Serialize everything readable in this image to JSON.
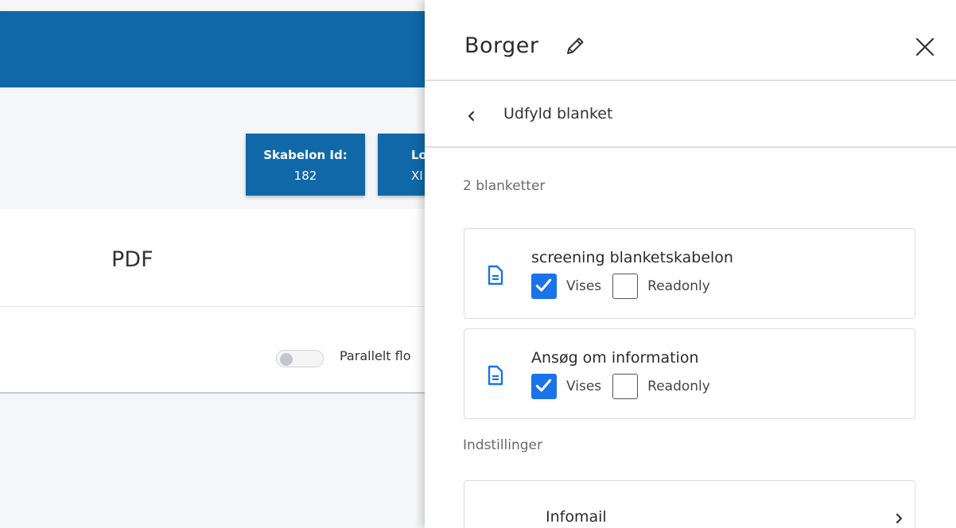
{
  "background": {
    "info_cards": [
      {
        "label": "Skabelon Id:",
        "value": "182"
      },
      {
        "label": "Lo",
        "value": "XI"
      }
    ],
    "pdf_title": "PDF",
    "toggle": {
      "label": "Parallelt flo",
      "on": false
    }
  },
  "panel": {
    "title": "Borger",
    "nav": {
      "back_label": "Udfyld blanket"
    },
    "forms_count": "2 blanketter",
    "forms": [
      {
        "name": "screening blanketskabelon",
        "vises_label": "Vises",
        "vises": true,
        "readonly_label": "Readonly",
        "readonly": false
      },
      {
        "name": "Ansøg om information",
        "vises_label": "Vises",
        "vises": true,
        "readonly_label": "Readonly",
        "readonly": false
      }
    ],
    "settings_label": "Indstillinger",
    "settings_items": [
      {
        "label": "Infomail"
      }
    ]
  },
  "colors": {
    "brand_blue": "#1168a8",
    "checkbox_blue": "#1a73e8",
    "doc_icon_blue": "#1a73e8"
  },
  "icons": [
    "pencil-icon",
    "close-icon",
    "chevron-left-icon",
    "document-icon",
    "checkmark-icon",
    "chevron-right-icon"
  ]
}
